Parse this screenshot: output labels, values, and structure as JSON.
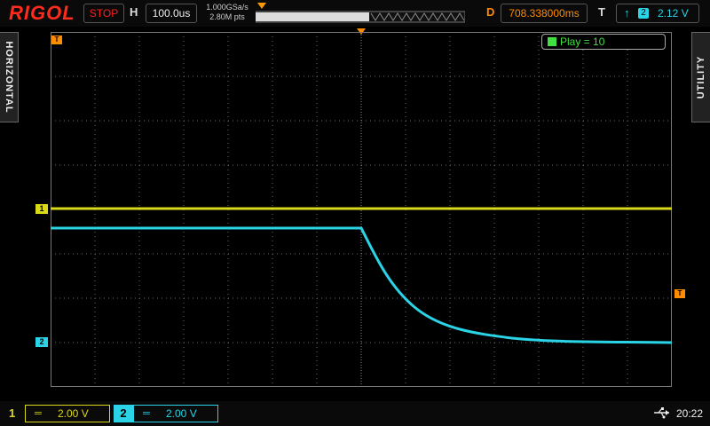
{
  "header": {
    "brand": "RIGOL",
    "run_state": "STOP",
    "horizontal_label": "H",
    "timebase": "100.0us",
    "sample_rate": "1.000GSa/s",
    "memory_depth": "2.80M pts",
    "delay_label": "D",
    "delay": "708.338000ms",
    "trigger_label": "T",
    "trigger_source": "2",
    "trigger_level": "2.12 V"
  },
  "side_tabs": {
    "left": "HORIZONTAL",
    "right": "UTILITY"
  },
  "playback": {
    "text": "Play = 10"
  },
  "markers": {
    "ch1": "1",
    "ch2": "2",
    "trigger": "T"
  },
  "channels": [
    {
      "number": "1",
      "scale": "2.00 V",
      "color": "#d9d91a"
    },
    {
      "number": "2",
      "scale": "2.00 V",
      "color": "#2ad3e6"
    }
  ],
  "status": {
    "time": "20:22"
  },
  "colors": {
    "ch1": "#d9d91a",
    "ch2": "#2ad3e6",
    "trigger": "#ff8c00",
    "brand": "#ff2b1c"
  }
}
